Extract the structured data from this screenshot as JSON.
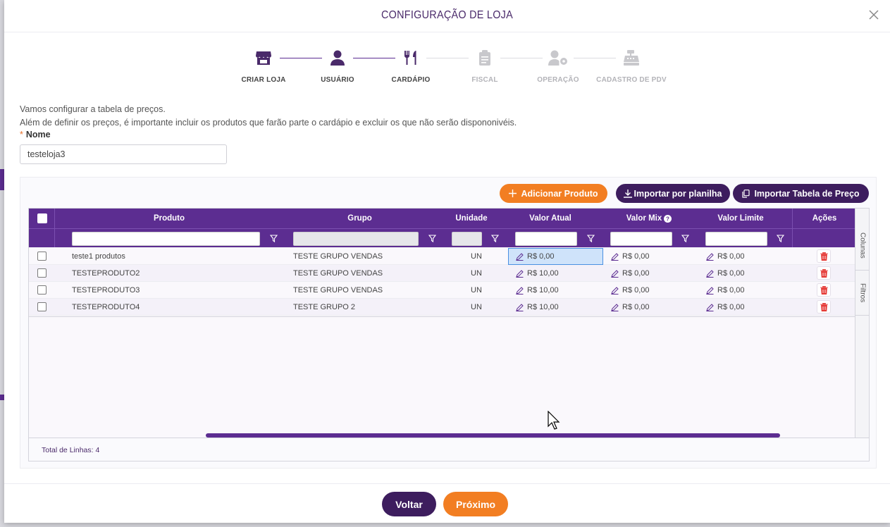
{
  "modal": {
    "title": "CONFIGURAÇÃO DE LOJA"
  },
  "steps": [
    {
      "label": "CRIAR LOJA",
      "icon": "store-icon",
      "active": true
    },
    {
      "label": "USUÁRIO",
      "icon": "user-icon",
      "active": true
    },
    {
      "label": "CARDÁPIO",
      "icon": "utensils-icon",
      "active": true
    },
    {
      "label": "FISCAL",
      "icon": "clipboard-icon",
      "active": false
    },
    {
      "label": "OPERAÇÃO",
      "icon": "user-gear-icon",
      "active": false
    },
    {
      "label": "CADASTRO DE PDV",
      "icon": "cash-register-icon",
      "active": false
    }
  ],
  "intro": {
    "line1": "Vamos configurar a tabela de preços.",
    "line2": "Além de definir os preços, é importante incluir os produtos que farão parte o cardápio e excluir os que não serão dispononivéis."
  },
  "name_field": {
    "label": "Nome",
    "required_mark": "*",
    "value": "testeloja3"
  },
  "toolbar": {
    "add_product": "Adicionar Produto",
    "import_sheet": "Importar por planilha",
    "import_price_table": "Importar Tabela de Preço"
  },
  "grid": {
    "columns": {
      "produto": "Produto",
      "grupo": "Grupo",
      "unidade": "Unidade",
      "valor_atual": "Valor Atual",
      "valor_mix": "Valor Mix",
      "valor_limite": "Valor Limite",
      "acoes": "Ações"
    },
    "rows": [
      {
        "produto": "teste1 produtos",
        "grupo": "TESTE GRUPO VENDAS",
        "unidade": "UN",
        "valor_atual": "R$ 0,00",
        "valor_mix": "R$ 0,00",
        "valor_limite": "R$ 0,00"
      },
      {
        "produto": "TESTEPRODUTO2",
        "grupo": "TESTE GRUPO VENDAS",
        "unidade": "UN",
        "valor_atual": "R$ 10,00",
        "valor_mix": "R$ 0,00",
        "valor_limite": "R$ 0,00"
      },
      {
        "produto": "TESTEPRODUTO3",
        "grupo": "TESTE GRUPO VENDAS",
        "unidade": "UN",
        "valor_atual": "R$ 10,00",
        "valor_mix": "R$ 0,00",
        "valor_limite": "R$ 0,00"
      },
      {
        "produto": "TESTEPRODUTO4",
        "grupo": "TESTE GRUPO 2",
        "unidade": "UN",
        "valor_atual": "R$ 10,00",
        "valor_mix": "R$ 0,00",
        "valor_limite": "R$ 0,00"
      }
    ],
    "side_tabs": {
      "columns": "Colunas",
      "filters": "Filtros"
    },
    "footer": "Total de Linhas: 4"
  },
  "footer": {
    "back": "Voltar",
    "next": "Próximo"
  },
  "colors": {
    "primary": "#5c2d91",
    "dark": "#3d1d5e",
    "accent": "#f27e22",
    "danger": "#e53935"
  }
}
